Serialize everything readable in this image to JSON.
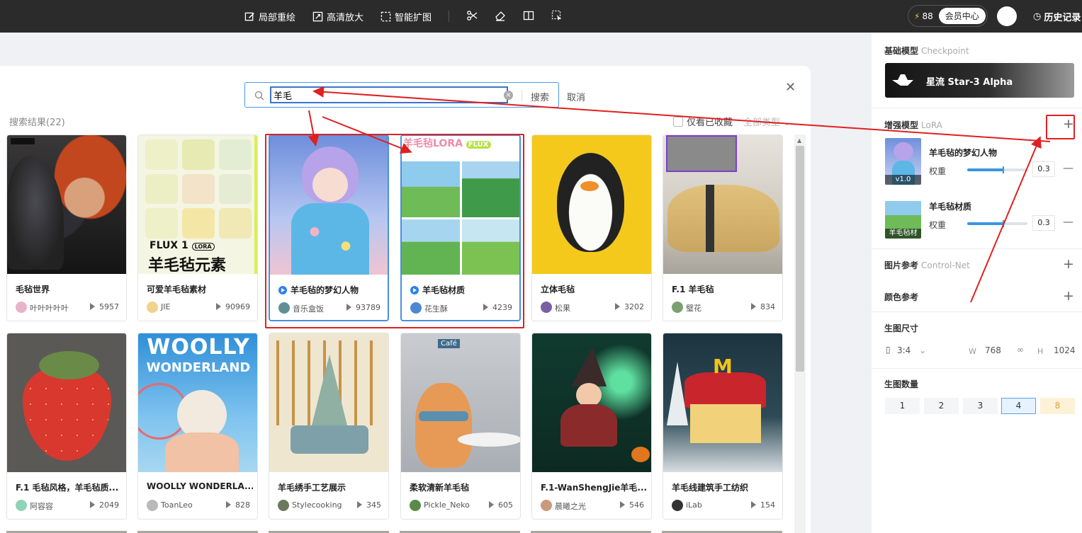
{
  "toolbar": {
    "items": [
      {
        "label": "局部重绘",
        "icon": "edit-icon"
      },
      {
        "label": "高清放大",
        "icon": "expand-icon"
      },
      {
        "label": "智能扩图",
        "icon": "crop-icon"
      }
    ],
    "icons": [
      "scissors-icon",
      "eraser-icon",
      "compare-icon",
      "select-icon"
    ],
    "credits": "88",
    "vip_label": "会员中心",
    "history_label": "历史记录"
  },
  "search": {
    "value": "羊毛",
    "button": "搜索",
    "cancel": "取消",
    "result_count": "搜索结果(22)",
    "fav_only": "仅看已收藏",
    "type_select": "全部类型"
  },
  "cards": [
    {
      "title": "毛毡世界",
      "author": "叶叶叶叶叶",
      "count": "5957",
      "play": false
    },
    {
      "title": "可爱羊毛毡素材",
      "author": "JIE",
      "count": "90969",
      "play": false,
      "thumb_text_top": "FLUX 1",
      "thumb_text_badge": "LORA",
      "thumb_text_main": "羊毛毡元素"
    },
    {
      "title": "羊毛毡的梦幻人物",
      "author": "音乐盒饭",
      "count": "93789",
      "play": true
    },
    {
      "title": "羊毛毡材质",
      "author": "花生酥",
      "count": "4239",
      "play": true,
      "thumb_text_top": "羊毛毡LORA",
      "thumb_text_badge": "FLUX"
    },
    {
      "title": "立体毛毡",
      "author": "松果",
      "count": "3202",
      "play": false
    },
    {
      "title": "F.1 羊毛毡",
      "author": "璧花",
      "count": "834",
      "play": false
    },
    {
      "title": "F.1 毛毡风格，羊毛毡质...",
      "author": "阿容容",
      "count": "2049",
      "play": false
    },
    {
      "title": "WOOLLY WONDERLA...",
      "author": "ToanLeo",
      "count": "828",
      "play": false,
      "thumb_text_top": "WOOLLY",
      "thumb_text_main": "WONDERLAND"
    },
    {
      "title": "羊毛绣手工艺展示",
      "author": "Stylecooking",
      "count": "345",
      "play": false
    },
    {
      "title": "柔软清新羊毛毡",
      "author": "Pickle_Neko",
      "count": "605",
      "play": false,
      "thumb_text_top": "Café"
    },
    {
      "title": "F.1-WanShengJie羊毛...",
      "author": "晨曦之光",
      "count": "546",
      "play": false
    },
    {
      "title": "羊毛线建筑手工纺织",
      "author": "iLab",
      "count": "154",
      "play": false
    }
  ],
  "sidebar": {
    "base_model": {
      "label": "基础模型",
      "en": "Checkpoint",
      "name": "星流 Star-3 Alpha"
    },
    "lora": {
      "label": "增强模型",
      "en": "LoRA",
      "items": [
        {
          "name": "羊毛毡的梦幻人物",
          "badge": "v1.0",
          "weight_label": "权重",
          "weight": "0.3",
          "slider_fraction": 0.6
        },
        {
          "name": "羊毛毡材质",
          "badge": "羊毛毡材",
          "weight_label": "权重",
          "weight": "0.3",
          "slider_fraction": 0.6
        }
      ]
    },
    "control_net": {
      "label": "图片参考",
      "en": "Control-Net"
    },
    "color_ref": {
      "label": "颜色参考"
    },
    "size": {
      "label": "生图尺寸",
      "ratio": "3:4",
      "w_label": "W",
      "w": "768",
      "h_label": "H",
      "h": "1024"
    },
    "count": {
      "label": "生图数量",
      "options": [
        "1",
        "2",
        "3",
        "4",
        "8"
      ],
      "selected": "4"
    }
  },
  "colors": {
    "accent": "#4a8fe0",
    "annotation": "#e02020",
    "topbar": "#2b2b2b"
  }
}
